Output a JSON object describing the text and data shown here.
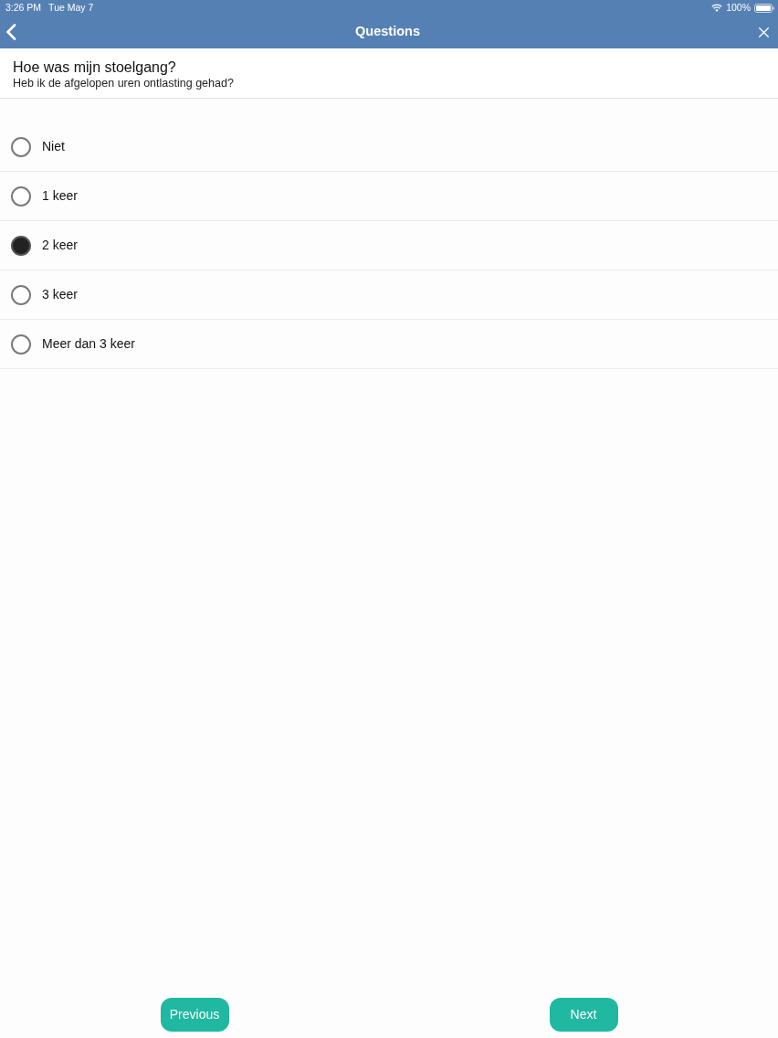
{
  "status_bar": {
    "time": "3:26 PM",
    "date": "Tue May 7",
    "battery": "100%"
  },
  "nav_bar": {
    "title": "Questions"
  },
  "question": {
    "title": "Hoe was mijn stoelgang?",
    "subtitle": "Heb ik de afgelopen uren ontlasting gehad?"
  },
  "options": [
    {
      "label": "Niet",
      "selected": false
    },
    {
      "label": "1 keer",
      "selected": false
    },
    {
      "label": "2 keer",
      "selected": true
    },
    {
      "label": "3 keer",
      "selected": false
    },
    {
      "label": "Meer dan 3 keer",
      "selected": false
    }
  ],
  "buttons": [
    {
      "label": "Previous"
    },
    {
      "label": "Next"
    }
  ]
}
